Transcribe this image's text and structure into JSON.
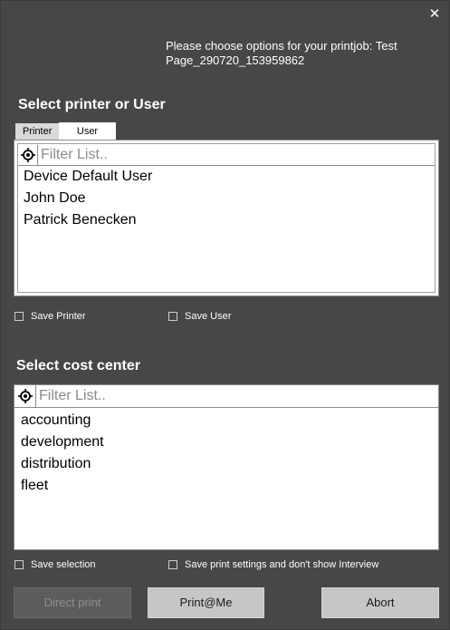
{
  "window": {
    "close_glyph": "✕"
  },
  "header": {
    "instructions": "Please choose options for your printjob: Test Page_290720_153959862"
  },
  "printer_section": {
    "title": "Select printer or User",
    "tabs": [
      {
        "label": "Printer",
        "active": false
      },
      {
        "label": "User",
        "active": true
      }
    ],
    "filter_placeholder": "Filter List..",
    "items": [
      "Device Default User",
      "John Doe",
      "Patrick Benecken"
    ]
  },
  "printer_options": {
    "save_printer": "Save Printer",
    "save_user": "Save User"
  },
  "cost_section": {
    "title": "Select cost center",
    "filter_placeholder": "Filter List..",
    "items": [
      "accounting",
      "development",
      "distribution",
      "fleet"
    ]
  },
  "cost_options": {
    "save_selection": "Save selection",
    "save_settings": "Save print settings and don't show Interview"
  },
  "buttons": {
    "direct_print": "Direct print",
    "print_at_me": "Print@Me",
    "abort": "Abort"
  },
  "colors": {
    "background": "#474747",
    "button_normal": "#c6c6c6",
    "button_disabled": "#5c5c5c"
  },
  "icons": {
    "filter": "target-icon",
    "close": "close-icon"
  }
}
